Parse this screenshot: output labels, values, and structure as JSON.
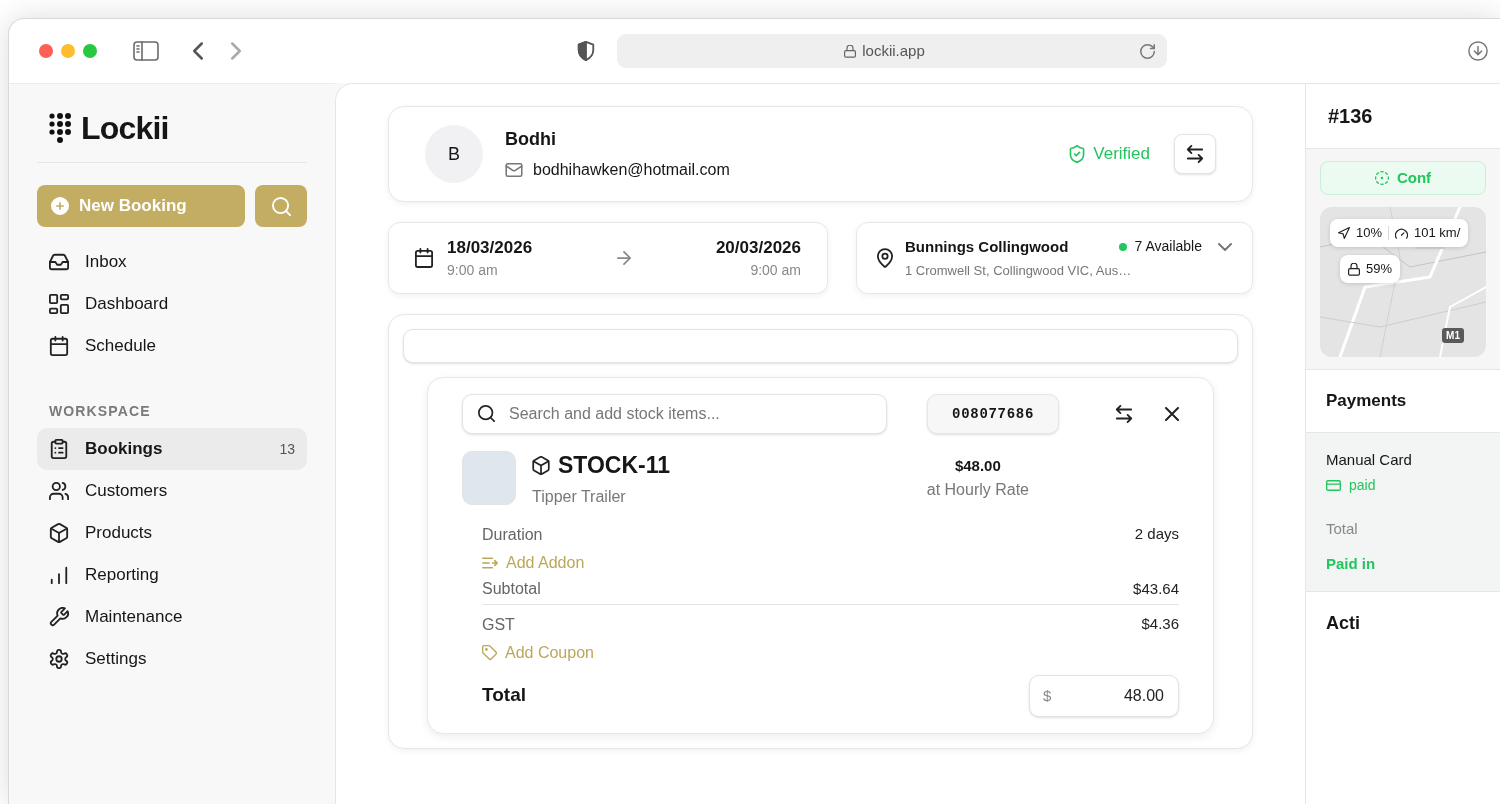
{
  "browser": {
    "url": "lockii.app"
  },
  "sidebar": {
    "logo": "Lockii",
    "new_booking": "New Booking",
    "nav": [
      {
        "label": "Inbox",
        "selected": false
      },
      {
        "label": "Dashboard",
        "selected": false
      },
      {
        "label": "Schedule",
        "selected": false
      }
    ],
    "section_title": "WORKSPACE",
    "workspace": [
      {
        "label": "Bookings",
        "selected": true,
        "count": "13"
      },
      {
        "label": "Customers",
        "selected": false
      },
      {
        "label": "Products",
        "selected": false
      },
      {
        "label": "Reporting",
        "selected": false
      },
      {
        "label": "Maintenance",
        "selected": false
      },
      {
        "label": "Settings",
        "selected": false
      }
    ]
  },
  "customer": {
    "initial": "B",
    "name": "Bodhi",
    "email": "bodhihawken@hotmail.com",
    "status": "Verified"
  },
  "dates": {
    "start_date": "18/03/2026",
    "start_time": "9:00 am",
    "end_date": "20/03/2026",
    "end_time": "9:00 am"
  },
  "location": {
    "name": "Bunnings Collingwood",
    "address": "1 Cromwell St, Collingwood VIC, Aus…",
    "availability": "7 Available"
  },
  "stock": {
    "search": {
      "placeholder": "Search and add stock items..."
    },
    "code": "008077686",
    "item": {
      "sku": "STOCK-11",
      "name": "Tipper Trailer",
      "price": "$48.00",
      "rate": "at Hourly Rate"
    },
    "summary": [
      {
        "kind": "line",
        "label": "Duration",
        "value": "2 days"
      },
      {
        "kind": "addon",
        "label": "Add Addon"
      },
      {
        "kind": "subtotal",
        "label": "Subtotal",
        "value": "$43.64"
      },
      {
        "kind": "line",
        "label": "GST",
        "value": "$4.36"
      },
      {
        "kind": "coupon",
        "label": "Add Coupon"
      },
      {
        "kind": "total",
        "label": "Total",
        "currency": "$",
        "value": "48.00"
      }
    ]
  },
  "order": {
    "number": "#136",
    "status": "Conf",
    "map": {
      "direction": "10%",
      "speed": "101 km/",
      "lock": "59%",
      "road": "M1"
    },
    "payments": {
      "title": "Payments",
      "method": "Manual Card",
      "status": "paid",
      "total_label": "Total",
      "total_status": "Paid in"
    },
    "activity_title": "Acti"
  }
}
